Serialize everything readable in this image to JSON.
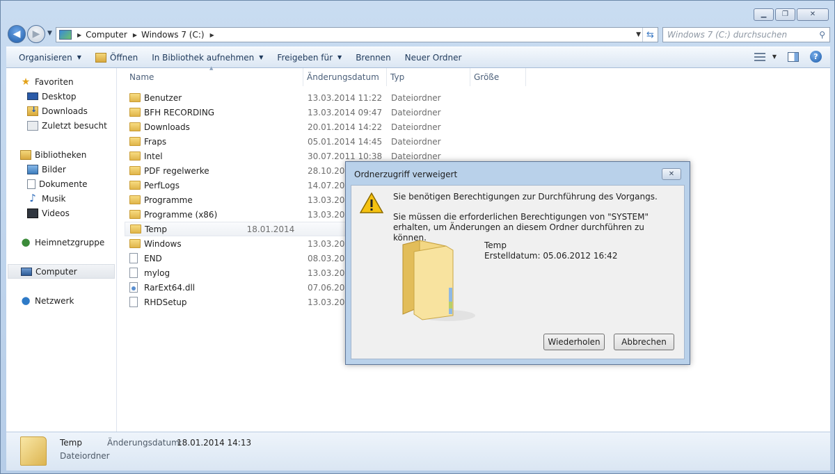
{
  "address": {
    "crumbs": [
      "Computer",
      "Windows 7 (C:)"
    ],
    "search_placeholder": "Windows 7 (C:) durchsuchen"
  },
  "toolbar": {
    "organize": "Organisieren",
    "open": "Öffnen",
    "include_library": "In Bibliothek aufnehmen",
    "share": "Freigeben für",
    "burn": "Brennen",
    "new_folder": "Neuer Ordner"
  },
  "nav": {
    "favorites": "Favoriten",
    "desktop": "Desktop",
    "downloads": "Downloads",
    "recent": "Zuletzt besucht",
    "libraries": "Bibliotheken",
    "pictures": "Bilder",
    "documents": "Dokumente",
    "music": "Musik",
    "videos": "Videos",
    "homegroup": "Heimnetzgruppe",
    "computer": "Computer",
    "network": "Netzwerk"
  },
  "columns": {
    "name": "Name",
    "date": "Änderungsdatum",
    "type": "Typ",
    "size": "Größe"
  },
  "files": [
    {
      "name": "Benutzer",
      "date": "13.03.2014 11:22",
      "type": "Dateiordner",
      "kind": "folder"
    },
    {
      "name": "BFH RECORDING",
      "date": "13.03.2014 09:47",
      "type": "Dateiordner",
      "kind": "folder"
    },
    {
      "name": "Downloads",
      "date": "20.01.2014 14:22",
      "type": "Dateiordner",
      "kind": "folder"
    },
    {
      "name": "Fraps",
      "date": "05.01.2014 14:45",
      "type": "Dateiordner",
      "kind": "folder"
    },
    {
      "name": "Intel",
      "date": "30.07.2011 10:38",
      "type": "Dateiordner",
      "kind": "folder"
    },
    {
      "name": "PDF regelwerke",
      "date": "28.10.2013",
      "type": "",
      "kind": "folder"
    },
    {
      "name": "PerfLogs",
      "date": "14.07.2009",
      "type": "",
      "kind": "folder"
    },
    {
      "name": "Programme",
      "date": "13.03.2014",
      "type": "",
      "kind": "folder"
    },
    {
      "name": "Programme (x86)",
      "date": "13.03.2014",
      "type": "",
      "kind": "folder"
    },
    {
      "name": "Temp",
      "date": "18.01.2014",
      "type": "",
      "kind": "folder"
    },
    {
      "name": "Windows",
      "date": "13.03.2014",
      "type": "",
      "kind": "folder"
    },
    {
      "name": "END",
      "date": "08.03.2013",
      "type": "",
      "kind": "file"
    },
    {
      "name": "mylog",
      "date": "13.03.2014",
      "type": "",
      "kind": "file"
    },
    {
      "name": "RarExt64.dll",
      "date": "07.06.2005",
      "type": "",
      "kind": "dll"
    },
    {
      "name": "RHDSetup",
      "date": "13.03.2014",
      "type": "",
      "kind": "file"
    }
  ],
  "details": {
    "name": "Temp",
    "date_label": "Änderungsdatum:",
    "date": "18.01.2014 14:13",
    "type": "Dateiordner"
  },
  "dialog": {
    "title": "Ordnerzugriff verweigert",
    "message1": "Sie benötigen Berechtigungen zur Durchführung des Vorgangs.",
    "message2": "Sie müssen die erforderlichen Berechtigungen von \"SYSTEM\" erhalten, um Änderungen an diesem Ordner durchführen zu können.",
    "folder_name": "Temp",
    "created": "Erstelldatum: 05.06.2012 16:42",
    "retry": "Wiederholen",
    "cancel": "Abbrechen"
  }
}
